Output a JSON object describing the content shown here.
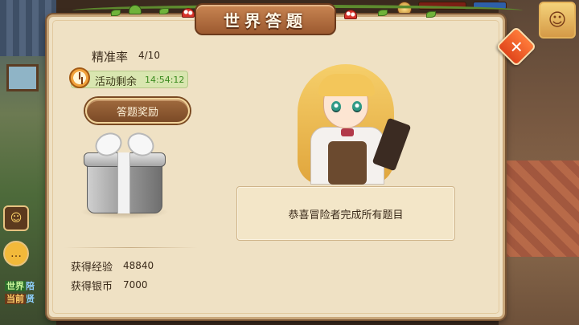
{
  "window": {
    "title": "世界答题",
    "close_icon": "close-icon"
  },
  "quiz": {
    "accuracy_label": "精准率",
    "accuracy_value": "4/10",
    "timer_label": "活动剩余",
    "timer_value": "14:54:12",
    "reward_button_label": "答题奖励",
    "message": "恭喜冒险者完成所有题目"
  },
  "rewards": [
    {
      "label": "获得经验",
      "value": "48840"
    },
    {
      "label": "获得银币",
      "value": "7000"
    }
  ],
  "chat": {
    "lines": [
      {
        "channel": "世界",
        "text": "陪"
      },
      {
        "channel": "当前",
        "text": "贤"
      }
    ]
  },
  "colors": {
    "panel_bg": "#efe1c4",
    "title_plate": "#b06c3e",
    "timer_value": "#3a8a1e",
    "close_button": "#e0461c"
  }
}
